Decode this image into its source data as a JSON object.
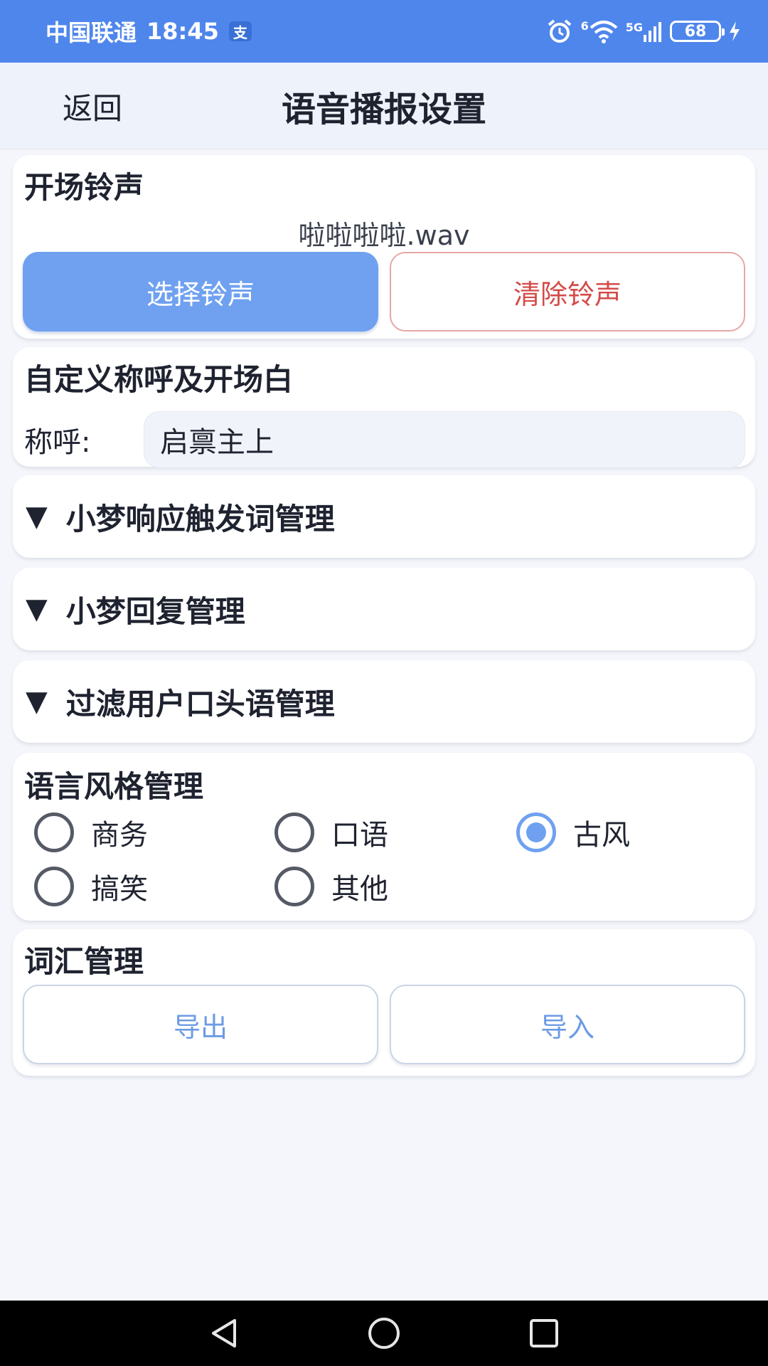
{
  "status_bar": {
    "carrier": "中国联通",
    "time": "18:45",
    "pay_badge": "支",
    "network": "5G",
    "wifi_label": "6",
    "battery": "68"
  },
  "header": {
    "back_label": "返回",
    "title": "语音播报设置"
  },
  "ringtone": {
    "title": "开场铃声",
    "file_name": "啦啦啦啦.wav",
    "select_label": "选择铃声",
    "clear_label": "清除铃声"
  },
  "greeting": {
    "title": "自定义称呼及开场白",
    "label": "称呼:",
    "value": "启禀主上"
  },
  "collapsibles": {
    "triangle": "▼",
    "triggers": "小梦响应触发词管理",
    "replies": "小梦回复管理",
    "filter": "过滤用户口头语管理"
  },
  "style": {
    "title": "语言风格管理",
    "options": [
      {
        "label": "商务",
        "checked": false
      },
      {
        "label": "口语",
        "checked": false
      },
      {
        "label": "古风",
        "checked": true
      },
      {
        "label": "搞笑",
        "checked": false
      },
      {
        "label": "其他",
        "checked": false
      }
    ]
  },
  "vocab": {
    "title": "词汇管理",
    "export_label": "导出",
    "import_label": "导入"
  },
  "colors": {
    "status_bar": "#4f86ec",
    "primary": "#6fa1f0",
    "danger": "#d34b48",
    "background": "#f4f6fb"
  },
  "nav_icons": [
    "back-triangle-icon",
    "home-circle-icon",
    "recents-square-icon"
  ]
}
